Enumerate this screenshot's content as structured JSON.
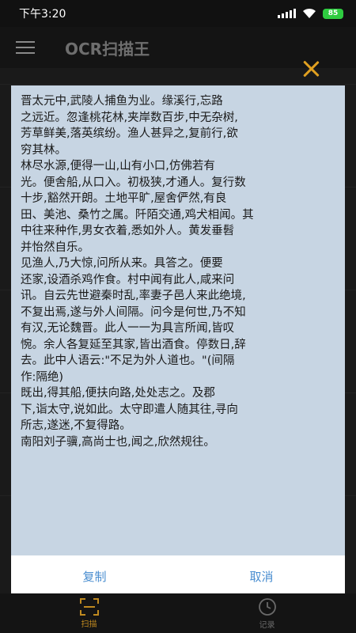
{
  "status_bar": {
    "time": "下午3:20",
    "battery": "85"
  },
  "app_bar": {
    "title": "OCR扫描王"
  },
  "dialog": {
    "text": "晋太元中,武陵人捕鱼为业。缘溪行,忘路\n之远近。忽逢桃花林,夹岸数百步,中无杂树,\n芳草鲜美,落英缤纷。渔人甚异之,复前行,欲\n穷其林。\n林尽水源,便得一山,山有小口,仿佛若有\n光。便舍船,从口入。初极狭,才通人。复行数\n十步,豁然开朗。土地平旷,屋舍俨然,有良\n田、美池、桑竹之属。阡陌交通,鸡犬相闻。其\n中往来种作,男女衣着,悉如外人。黄发垂髫\n并怡然自乐。\n见渔人,乃大惊,问所从来。具答之。便要\n还家,设酒杀鸡作食。村中闻有此人,咸来问\n讯。自云先世避秦时乱,率妻子邑人来此绝境,\n不复出焉,遂与外人间隔。问今是何世,乃不知\n有汉,无论魏晋。此人一一为具言所闻,皆叹\n惋。余人各复延至其家,皆出酒食。停数日,辞\n去。此中人语云:\"不足为外人道也。\"(间隔\n作:隔绝)\n既出,得其船,便扶向路,处处志之。及郡\n下,诣太守,说如此。太守即遣人随其往,寻向\n所志,遂迷,不复得路。\n南阳刘子骥,高尚士也,闻之,欣然规往。",
    "copy_label": "复制",
    "cancel_label": "取消"
  },
  "bottom_nav": {
    "items": [
      {
        "label": "扫描",
        "icon": "scan-icon",
        "active": true
      },
      {
        "label": "记录",
        "icon": "clock-icon",
        "active": false
      }
    ]
  },
  "colors": {
    "accent": "#c08a20",
    "close": "#e0a020",
    "dialog_bg": "#c7d5e3",
    "button_text": "#4a8ed0"
  }
}
